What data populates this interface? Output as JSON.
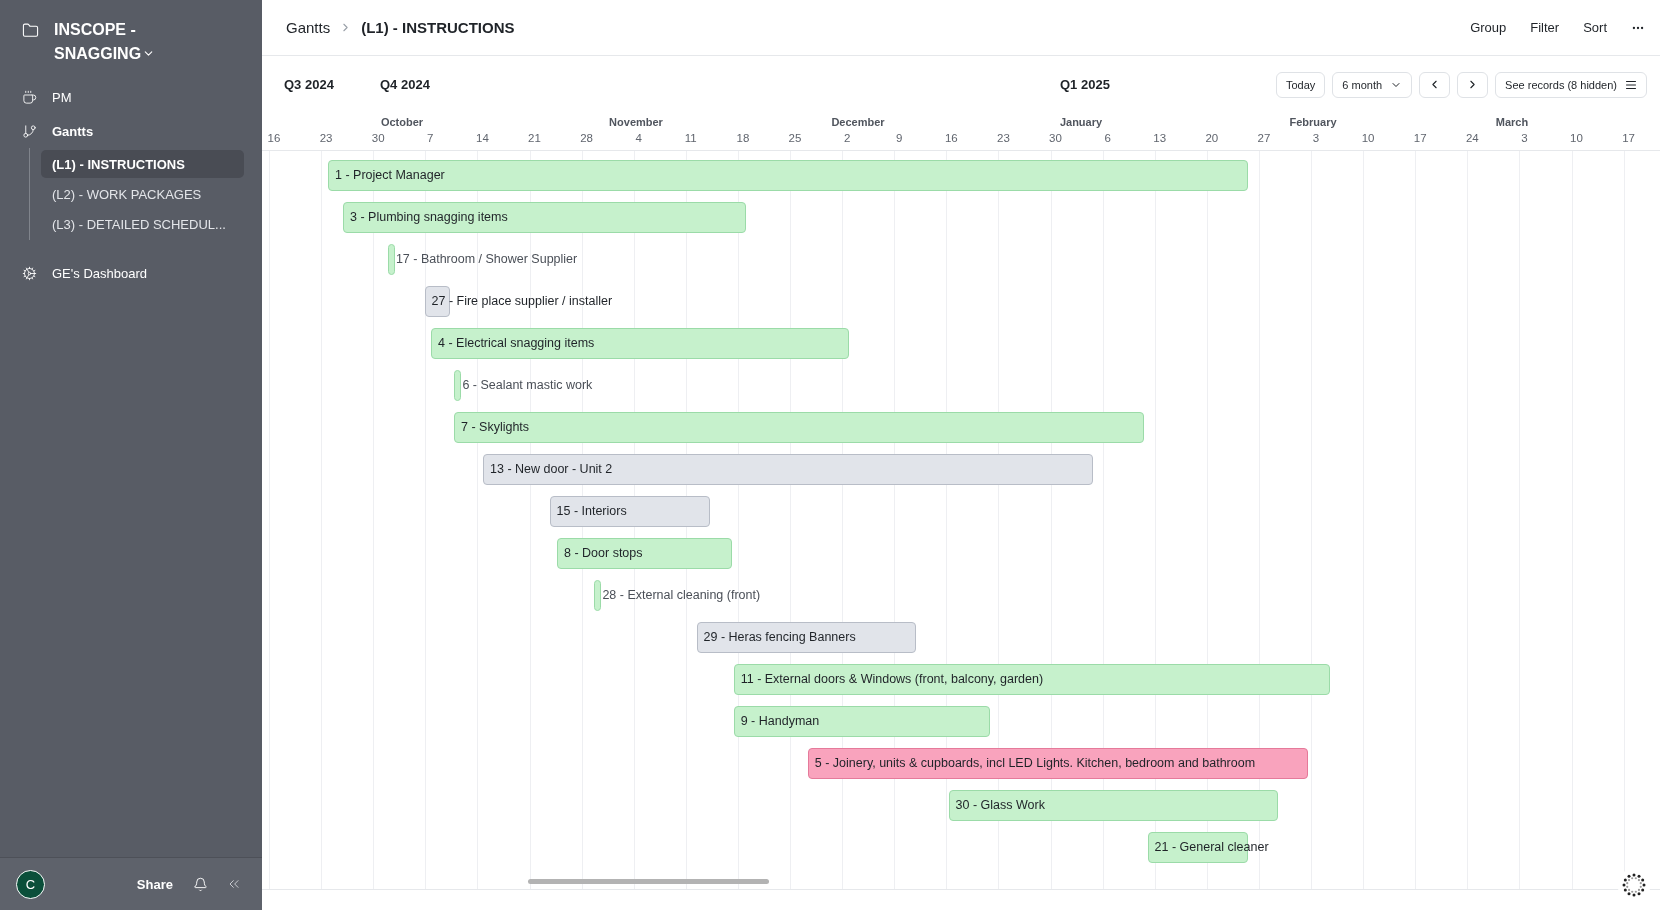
{
  "sidebar": {
    "workspace": "INSCOPE - SNAGGING",
    "items": [
      {
        "label": "PM",
        "kind": "link"
      },
      {
        "label": "Gantts",
        "kind": "group",
        "children": [
          {
            "label": "(L1) - INSTRUCTIONS",
            "selected": true
          },
          {
            "label": "(L2) - WORK PACKAGES",
            "selected": false
          },
          {
            "label": "(L3) - DETAILED SCHEDUL...",
            "selected": false
          }
        ]
      },
      {
        "label": "GE's Dashboard",
        "kind": "dashboard"
      }
    ],
    "footer": {
      "avatar": "C",
      "share": "Share"
    }
  },
  "breadcrumb": [
    "Gantts",
    "(L1) - INSTRUCTIONS"
  ],
  "header_actions": [
    "Group",
    "Filter",
    "Sort"
  ],
  "toolbar": {
    "today": "Today",
    "range": "6 month",
    "records": "See records (8 hidden)"
  },
  "timeline": {
    "quarters": [
      "Q3 2024",
      "Q4 2024",
      "Q1 2025"
    ],
    "months": [
      "October",
      "November",
      "December",
      "January",
      "February",
      "March"
    ],
    "weeks": [
      "16",
      "23",
      "30",
      "7",
      "14",
      "21",
      "28",
      "4",
      "11",
      "18",
      "25",
      "2",
      "9",
      "16",
      "23",
      "30",
      "6",
      "13",
      "20",
      "27",
      "3",
      "10",
      "17",
      "24",
      "3",
      "10",
      "17"
    ]
  },
  "tasks": [
    {
      "label": "1 - Project Manager",
      "color": "#c6f1cc"
    },
    {
      "label": "3 - Plumbing snagging items",
      "color": "#c6f1cc"
    },
    {
      "label": "17 - Bathroom / Shower Supplier",
      "color": "#c6f1cc"
    },
    {
      "label": "27 - Fire place supplier / installer",
      "color": "#e1e4ea"
    },
    {
      "label": "4 - Electrical snagging items",
      "color": "#c6f1cc"
    },
    {
      "label": "6 - Sealant mastic work",
      "color": "#c6f1cc"
    },
    {
      "label": "7 - Skylights",
      "color": "#c6f1cc"
    },
    {
      "label": "13 - New door - Unit 2",
      "color": "#e1e4ea"
    },
    {
      "label": "15 - Interiors",
      "color": "#e1e4ea"
    },
    {
      "label": "8 - Door stops",
      "color": "#c6f1cc"
    },
    {
      "label": "28 - External cleaning (front)",
      "color": "#c6f1cc"
    },
    {
      "label": "29 - Heras fencing Banners",
      "color": "#e1e4ea"
    },
    {
      "label": "11 - External doors & Windows (front, balcony, garden)",
      "color": "#c6f1cc"
    },
    {
      "label": "9 - Handyman",
      "color": "#c6f1cc"
    },
    {
      "label": "5 - Joinery, units & cupboards, incl LED Lights. Kitchen, bedroom and bathroom",
      "color": "#f9a3bd"
    },
    {
      "label": "30 - Glass Work",
      "color": "#c6f1cc"
    },
    {
      "label": "21 - General cleaner",
      "color": "#c6f1cc"
    }
  ]
}
